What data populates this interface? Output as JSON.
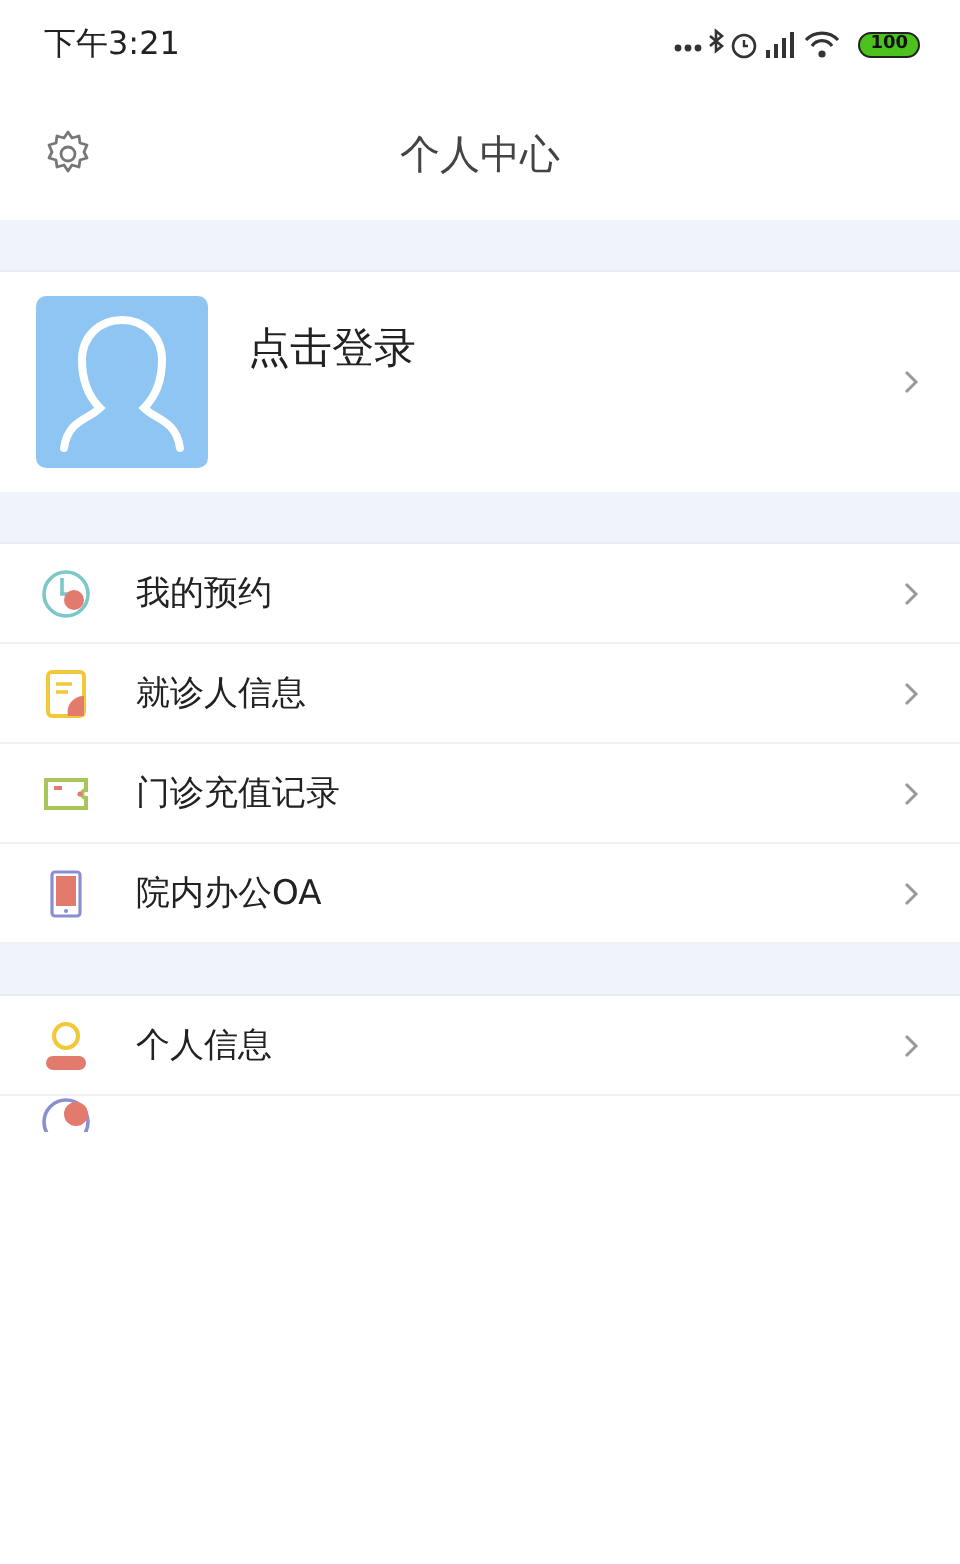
{
  "status_bar": {
    "time": "下午3:21",
    "battery": "100"
  },
  "header": {
    "title": "个人中心"
  },
  "profile": {
    "login_label": "点击登录"
  },
  "menu_groups": [
    {
      "items": [
        {
          "kind": "clock",
          "label": "我的预约"
        },
        {
          "kind": "document",
          "label": "就诊人信息"
        },
        {
          "kind": "card",
          "label": "门诊充值记录"
        },
        {
          "kind": "phone",
          "label": "院内办公OA"
        }
      ]
    },
    {
      "items": [
        {
          "kind": "person",
          "label": "个人信息"
        }
      ],
      "partial_item": {
        "kind": "globe"
      }
    }
  ]
}
